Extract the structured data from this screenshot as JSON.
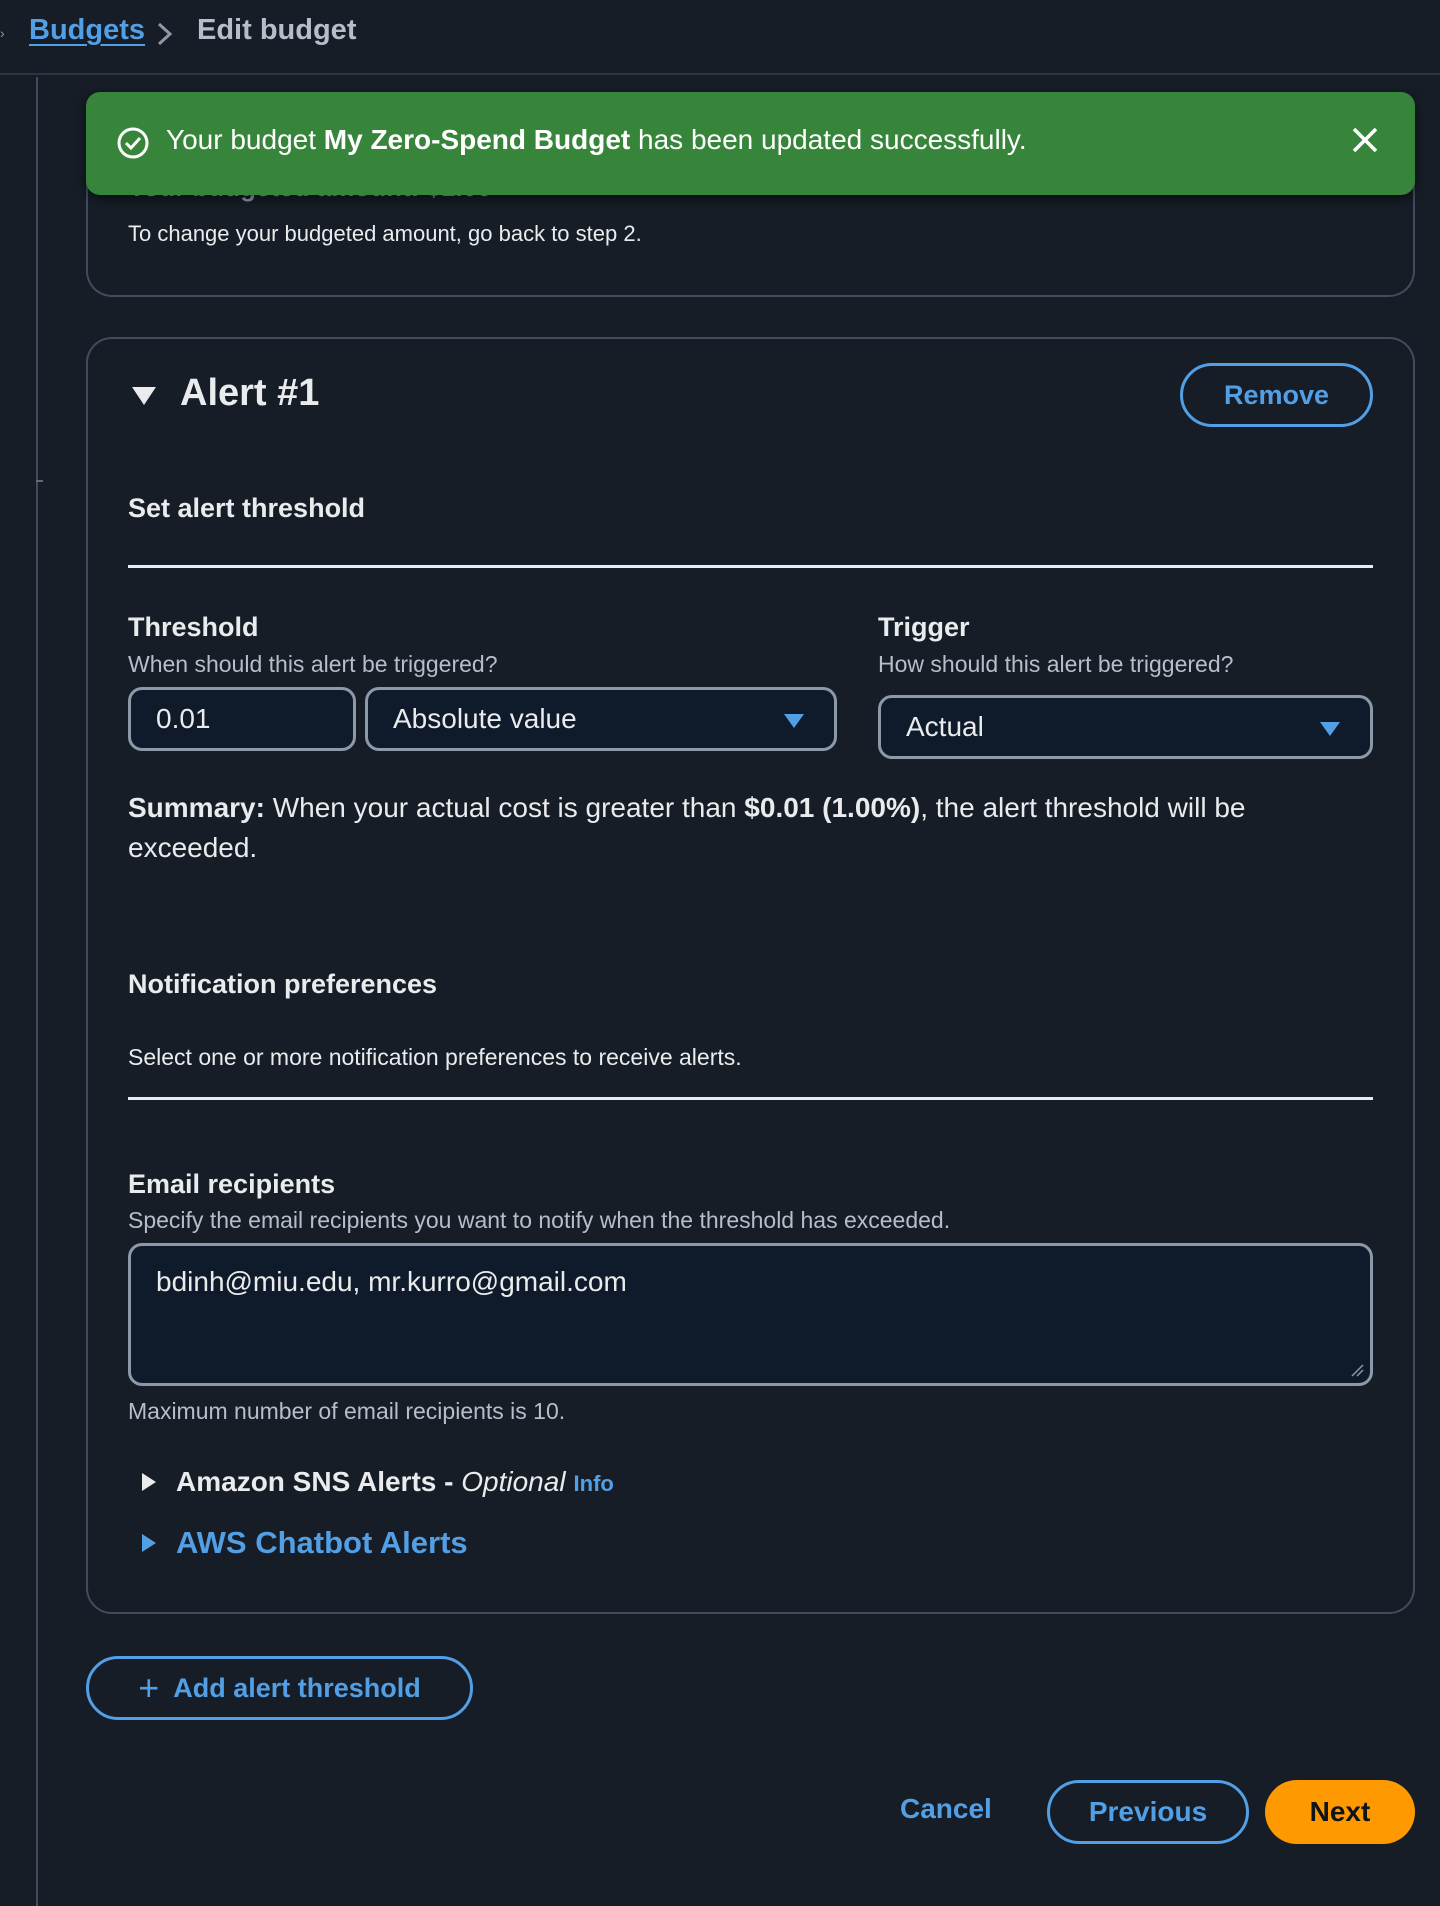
{
  "breadcrumb": {
    "link": "Budgets",
    "current": "Edit budget"
  },
  "flash": {
    "prefix": "Your budget ",
    "budget_name": "My Zero-Spend Budget",
    "suffix": " has been updated successfully."
  },
  "budget_amount": {
    "partial_heading": "Your budgeted amount: $1.00",
    "help": "To change your budgeted amount, go back to step 2."
  },
  "alert": {
    "title": "Alert #1",
    "remove_label": "Remove",
    "threshold_section": "Set alert threshold",
    "threshold": {
      "label": "Threshold",
      "description": "When should this alert be triggered?",
      "value": "0.01",
      "type": "Absolute value"
    },
    "trigger": {
      "label": "Trigger",
      "description": "How should this alert be triggered?",
      "value": "Actual"
    },
    "summary": {
      "label": "Summary:",
      "text_before": " When your actual cost is greater than ",
      "amount": "$0.01 (1.00%)",
      "text_after": ", the alert threshold will be exceeded."
    },
    "notification": {
      "heading": "Notification preferences",
      "description": "Select one or more notification preferences to receive alerts."
    },
    "email": {
      "label": "Email recipients",
      "description": "Specify the email recipients you want to notify when the threshold has exceeded.",
      "value": "bdinh@miu.edu, mr.kurro@gmail.com",
      "hint": "Maximum number of email recipients is 10."
    },
    "sns": {
      "label": "Amazon SNS Alerts - ",
      "optional": "Optional",
      "info": "Info"
    },
    "chatbot": {
      "label": "AWS Chatbot Alerts"
    }
  },
  "actions": {
    "add_threshold": "Add alert threshold",
    "cancel": "Cancel",
    "previous": "Previous",
    "next": "Next"
  },
  "colors": {
    "background": "#161d26",
    "link": "#539fe5",
    "success": "#37853a",
    "primary_button": "#ff9900"
  }
}
